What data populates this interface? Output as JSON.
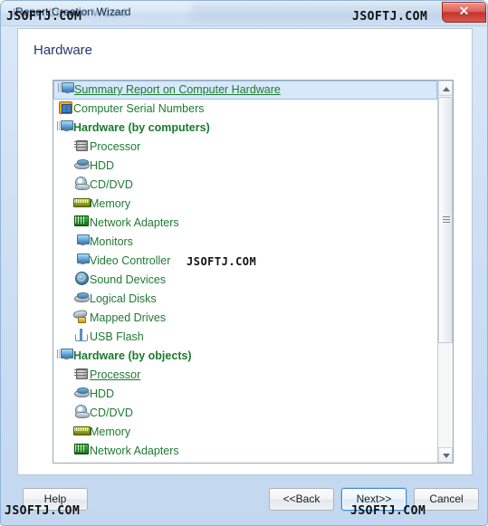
{
  "window": {
    "title": "Report Creation Wizard",
    "close_label": "✕"
  },
  "page": {
    "heading": "Hardware"
  },
  "list": {
    "items": [
      {
        "label": "Summary Report on Computer Hardware",
        "icon": "monitor-network-icon",
        "level": 0,
        "group": false,
        "selected": true,
        "underline": true
      },
      {
        "label": "Computer Serial Numbers",
        "icon": "windows-icon",
        "level": 0,
        "group": false,
        "selected": false,
        "underline": false
      },
      {
        "label": "Hardware (by computers)",
        "icon": "monitor-network-icon",
        "level": 0,
        "group": true,
        "selected": false,
        "underline": false
      },
      {
        "label": "Processor",
        "icon": "cpu-icon",
        "level": 1,
        "group": false,
        "selected": false,
        "underline": false
      },
      {
        "label": "HDD",
        "icon": "hard-disk-icon",
        "level": 1,
        "group": false,
        "selected": false,
        "underline": false
      },
      {
        "label": "CD/DVD",
        "icon": "optical-drive-icon",
        "level": 1,
        "group": false,
        "selected": false,
        "underline": false
      },
      {
        "label": "Memory",
        "icon": "memory-icon",
        "level": 1,
        "group": false,
        "selected": false,
        "underline": false
      },
      {
        "label": "Network Adapters",
        "icon": "network-card-icon",
        "level": 1,
        "group": false,
        "selected": false,
        "underline": false
      },
      {
        "label": "Monitors",
        "icon": "monitor-icon",
        "level": 1,
        "group": false,
        "selected": false,
        "underline": false
      },
      {
        "label": "Video Controller",
        "icon": "monitor-icon",
        "level": 1,
        "group": false,
        "selected": false,
        "underline": false
      },
      {
        "label": "Sound Devices",
        "icon": "speaker-icon",
        "level": 1,
        "group": false,
        "selected": false,
        "underline": false
      },
      {
        "label": "Logical Disks",
        "icon": "hard-disk-icon",
        "level": 1,
        "group": false,
        "selected": false,
        "underline": false
      },
      {
        "label": "Mapped Drives",
        "icon": "mapped-drive-icon",
        "level": 1,
        "group": false,
        "selected": false,
        "underline": false
      },
      {
        "label": "USB Flash",
        "icon": "usb-icon",
        "level": 1,
        "group": false,
        "selected": false,
        "underline": false
      },
      {
        "label": "Hardware (by objects)",
        "icon": "monitor-network-icon",
        "level": 0,
        "group": true,
        "selected": false,
        "underline": false
      },
      {
        "label": "Processor",
        "icon": "cpu-icon",
        "level": 1,
        "group": false,
        "selected": false,
        "underline": true
      },
      {
        "label": "HDD",
        "icon": "hard-disk-icon",
        "level": 1,
        "group": false,
        "selected": false,
        "underline": false
      },
      {
        "label": "CD/DVD",
        "icon": "optical-drive-icon",
        "level": 1,
        "group": false,
        "selected": false,
        "underline": false
      },
      {
        "label": "Memory",
        "icon": "memory-icon",
        "level": 1,
        "group": false,
        "selected": false,
        "underline": false
      },
      {
        "label": "Network Adapters",
        "icon": "network-card-icon",
        "level": 1,
        "group": false,
        "selected": false,
        "underline": false
      }
    ]
  },
  "scrollbar": {
    "up_arrow": "scroll-up-arrow",
    "down_arrow": "scroll-down-arrow"
  },
  "buttons": {
    "help": "Help",
    "back": "<<Back",
    "next": "Next>>",
    "cancel": "Cancel"
  },
  "watermarks": {
    "top_left": "JSOFTJ.COM",
    "top_right": "JSOFTJ.COM",
    "middle": "JSOFTJ.COM",
    "bottom_left": "JSOFTJ.COM",
    "bottom_right": "JSOFTJ.COM"
  },
  "colors": {
    "heading": "#28356b",
    "list_text": "#1f7a33",
    "group_text": "#1a7a2e",
    "selection_bg": "#d6e8f9",
    "selection_border": "#9cc3e6",
    "close_button": "#c4342c",
    "focus_ring": "#3c8bc8"
  }
}
